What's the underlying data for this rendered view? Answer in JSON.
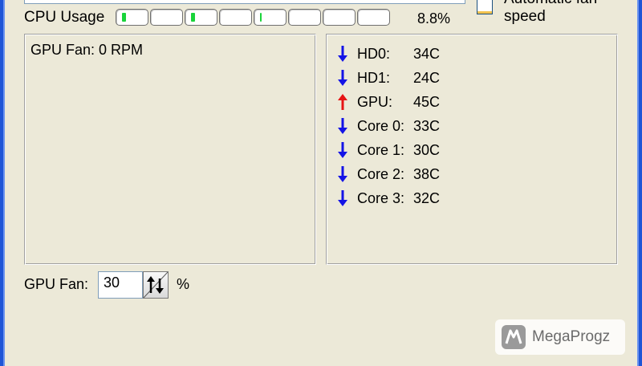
{
  "cpu": {
    "label": "CPU Usage",
    "value_text": "8.8%",
    "cores": [
      {
        "level": 0.08
      },
      {
        "level": 0.0
      },
      {
        "level": 0.08
      },
      {
        "level": 0.0
      },
      {
        "level": 0.03
      },
      {
        "level": 0.0
      },
      {
        "level": 0.0
      },
      {
        "level": 0.0
      }
    ]
  },
  "auto_fan": {
    "label": "Automatic fan speed",
    "checked": false
  },
  "fan_panel": {
    "text": "GPU Fan: 0 RPM"
  },
  "temperatures": [
    {
      "name": "HD0:",
      "value": "34C",
      "trend": "down"
    },
    {
      "name": "HD1:",
      "value": "24C",
      "trend": "down"
    },
    {
      "name": "GPU:",
      "value": "45C",
      "trend": "up"
    },
    {
      "name": "Core 0:",
      "value": "33C",
      "trend": "down"
    },
    {
      "name": "Core 1:",
      "value": "30C",
      "trend": "down"
    },
    {
      "name": "Core 2:",
      "value": "38C",
      "trend": "down"
    },
    {
      "name": "Core 3:",
      "value": "32C",
      "trend": "down"
    }
  ],
  "gpu_fan_control": {
    "label": "GPU Fan:",
    "value": "30",
    "unit": "%"
  },
  "watermark": {
    "text": "MegaProgz"
  },
  "colors": {
    "arrow_down": "#1414e6",
    "arrow_up": "#e61414",
    "cpu_fill": "#19d43a"
  }
}
